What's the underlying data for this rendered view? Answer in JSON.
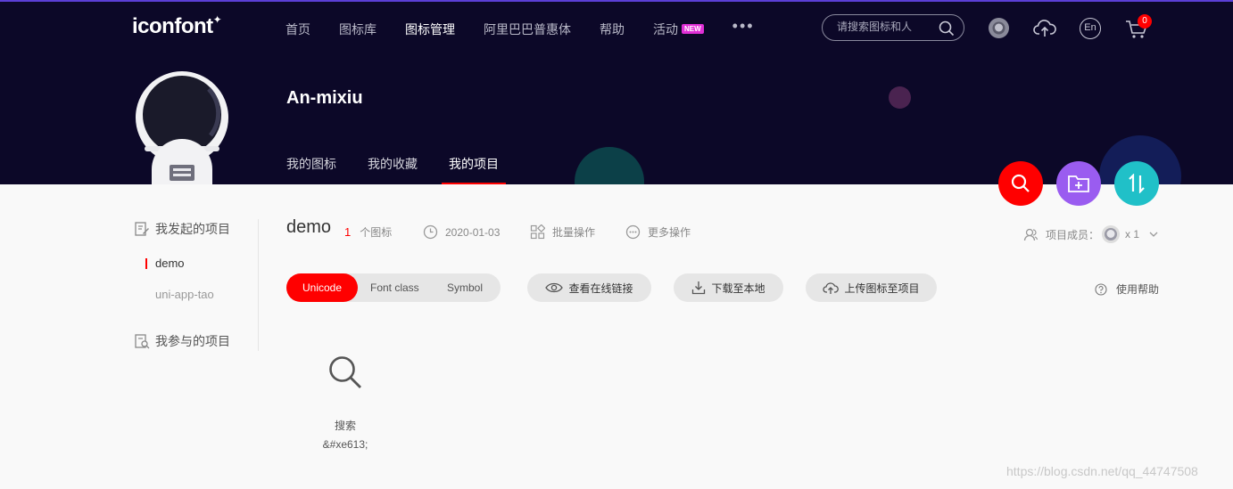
{
  "header": {
    "logo": "iconfont",
    "logo_mark": "✦",
    "nav": [
      {
        "label": "首页",
        "active": false
      },
      {
        "label": "图标库",
        "active": false
      },
      {
        "label": "图标管理",
        "active": true
      },
      {
        "label": "阿里巴巴普惠体",
        "active": false
      },
      {
        "label": "帮助",
        "active": false
      },
      {
        "label": "活动",
        "active": false,
        "badge": "NEW"
      }
    ],
    "more": "•••",
    "search_placeholder": "请搜索图标和人",
    "lang_label": "En",
    "cart_count": "0"
  },
  "profile": {
    "username": "An-mixiu",
    "tabs": [
      {
        "label": "我的图标",
        "active": false
      },
      {
        "label": "我的收藏",
        "active": false
      },
      {
        "label": "我的项目",
        "active": true
      }
    ]
  },
  "sidebar": {
    "initiated_title": "我发起的项目",
    "projects": [
      {
        "label": "demo",
        "active": true
      },
      {
        "label": "uni-app-tao",
        "active": false
      }
    ],
    "joined_title": "我参与的项目"
  },
  "project": {
    "name": "demo",
    "icon_count": "1",
    "icon_count_unit": "个图标",
    "date": "2020-01-03",
    "batch_label": "批量操作",
    "more_label": "更多操作",
    "members_label": "项目成员：",
    "members_count": "x 1"
  },
  "toolbar": {
    "modes": [
      "Unicode",
      "Font class",
      "Symbol"
    ],
    "active_mode": "Unicode",
    "view_link": "查看在线链接",
    "download": "下载至本地",
    "upload": "上传图标至项目",
    "help": "使用帮助"
  },
  "icons": [
    {
      "name": "搜索",
      "code": "&#xe613;",
      "icon": "search-icon"
    }
  ],
  "watermark": "https://blog.csdn.net/qq_44747508",
  "colors": {
    "header_bg": "#0c0828",
    "accent_red": "#ff0000",
    "fab_purple": "#9a5cf0",
    "fab_teal": "#20c0c8"
  }
}
